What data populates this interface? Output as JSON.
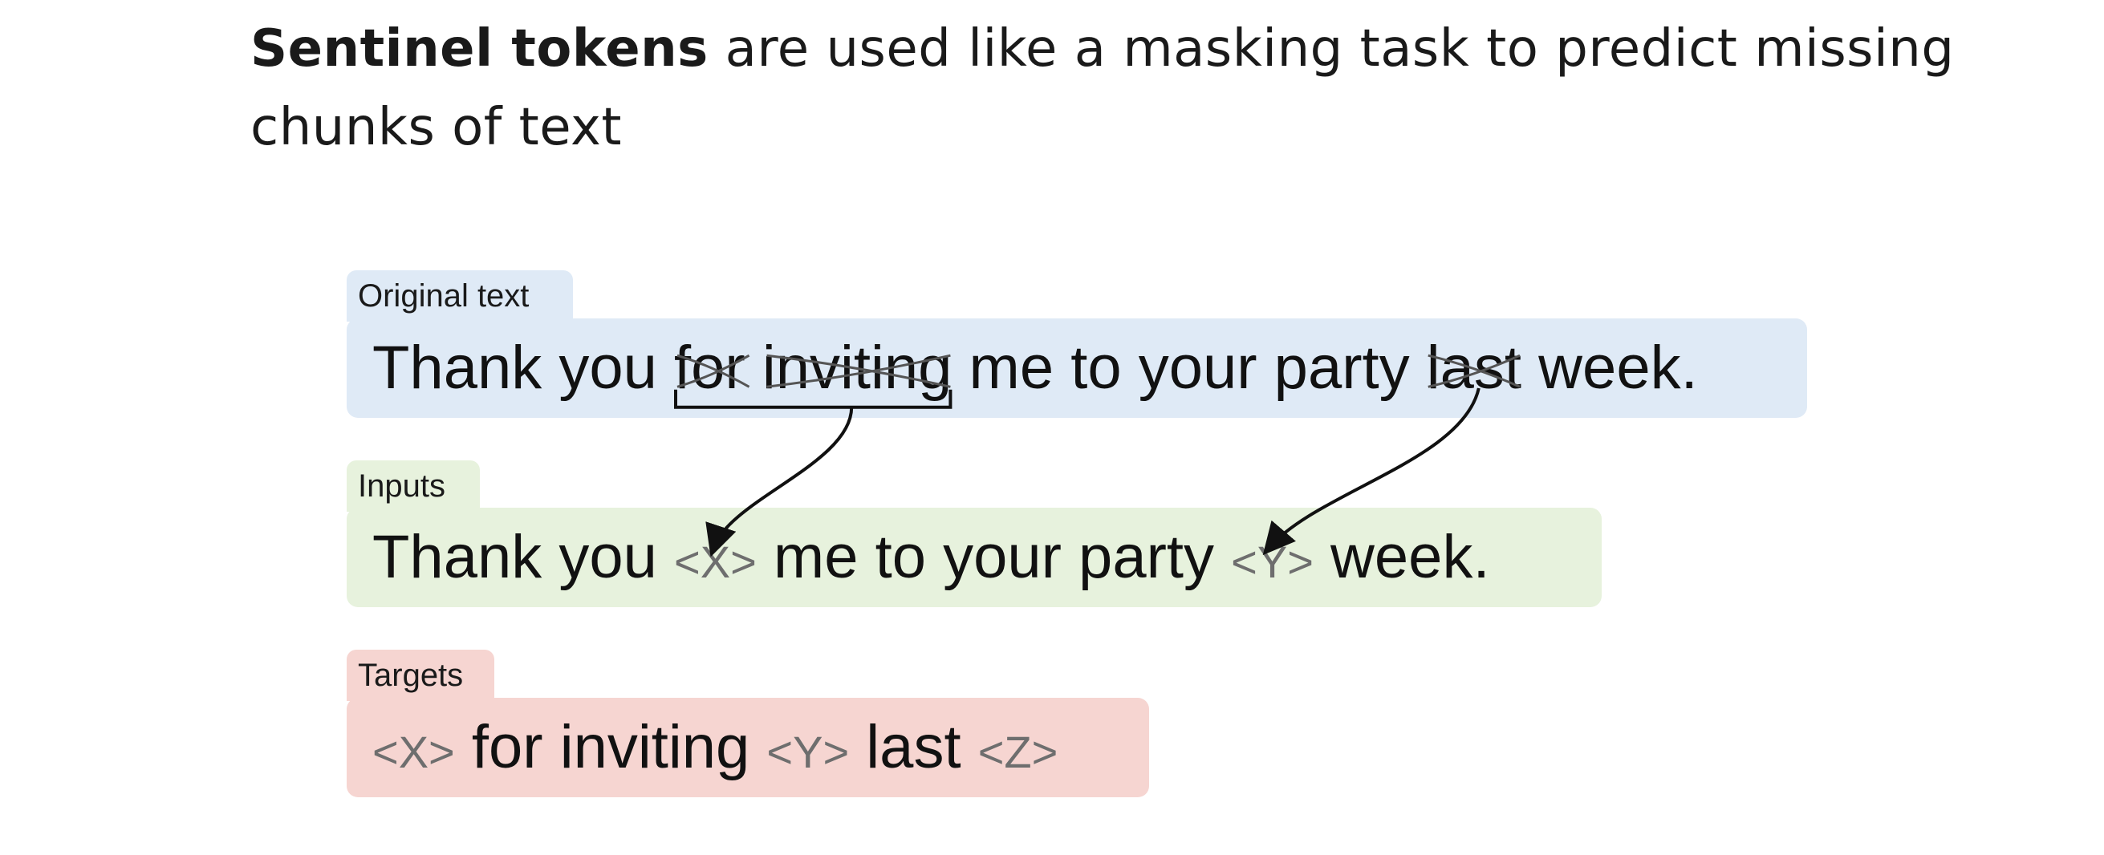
{
  "heading": {
    "bold": "Sentinel tokens",
    "rest_line1": " are used like a masking task to predict missing",
    "line2": "chunks of text"
  },
  "original": {
    "label": "Original text",
    "w1": "Thank you",
    "w2": "for inviting",
    "w3": "me to your party",
    "w4": "last",
    "w5": "week."
  },
  "inputs": {
    "label": "Inputs",
    "w1": "Thank you",
    "t1": "<X>",
    "w2": "me to your party",
    "t2": "<Y>",
    "w3": "week."
  },
  "targets": {
    "label": "Targets",
    "t1": "<X>",
    "w1": "for inviting",
    "t2": "<Y>",
    "w2": "last",
    "t3": "<Z>"
  }
}
